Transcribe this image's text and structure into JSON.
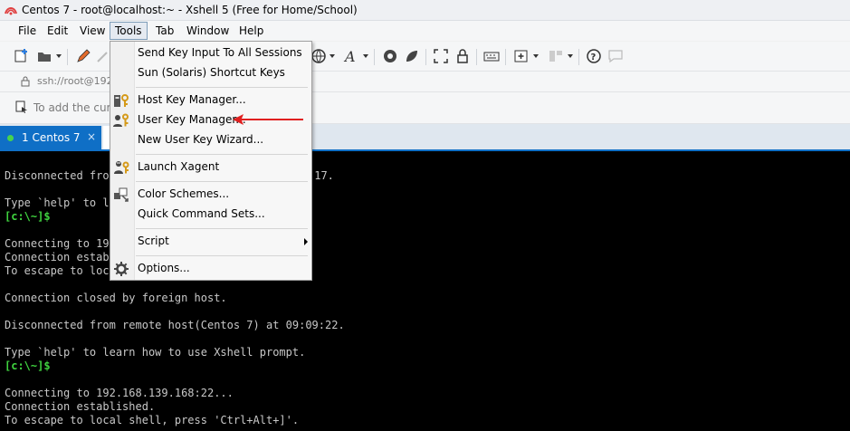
{
  "window": {
    "title": "Centos 7 - root@localhost:~ - Xshell 5 (Free for Home/School)"
  },
  "menubar": {
    "items": [
      "File",
      "Edit",
      "View",
      "Tools",
      "Tab",
      "Window",
      "Help"
    ],
    "active": "Tools"
  },
  "addressbar": {
    "address": "ssh://root@192"
  },
  "hintbar": {
    "text": "To add the curre"
  },
  "tabs": [
    {
      "label": "1 Centos 7",
      "close": "×"
    }
  ],
  "terminal": {
    "lines": [
      {
        "text": "Disconnected from",
        "kind": "normal"
      },
      {
        "text": "",
        "kind": "normal"
      },
      {
        "text": "Type `help' to le",
        "kind": "normal"
      },
      {
        "text": "[c:\\~]$",
        "kind": "prompt"
      },
      {
        "text": "",
        "kind": "normal"
      },
      {
        "text": "Connecting to 192",
        "kind": "normal"
      },
      {
        "text": "Connection establ",
        "kind": "normal"
      },
      {
        "text": "To escape to loca",
        "kind": "normal"
      },
      {
        "text": "",
        "kind": "normal"
      },
      {
        "text": "Connection closed by foreign host.",
        "kind": "normal"
      },
      {
        "text": "",
        "kind": "normal"
      },
      {
        "text": "Disconnected from remote host(Centos 7) at 09:09:22.",
        "kind": "normal"
      },
      {
        "text": "",
        "kind": "normal"
      },
      {
        "text": "Type `help' to learn how to use Xshell prompt.",
        "kind": "normal"
      },
      {
        "text": "[c:\\~]$",
        "kind": "prompt"
      },
      {
        "text": "",
        "kind": "normal"
      },
      {
        "text": "Connecting to 192.168.139.168:22...",
        "kind": "normal"
      },
      {
        "text": "Connection established.",
        "kind": "normal"
      },
      {
        "text": "To escape to local shell, press 'Ctrl+Alt+]'.",
        "kind": "normal"
      }
    ],
    "partial_right": ":17."
  },
  "tools_menu": {
    "items": [
      {
        "label": "Send Key Input To All Sessions",
        "icon": ""
      },
      {
        "label": "Sun (Solaris) Shortcut Keys",
        "icon": ""
      },
      {
        "label": "Host Key Manager...",
        "icon": "host-key-icon"
      },
      {
        "label": "User Key Manager...",
        "icon": "user-key-icon"
      },
      {
        "label": "New User Key Wizard...",
        "icon": ""
      },
      {
        "label": "Launch Xagent",
        "icon": "xagent-icon"
      },
      {
        "label": "Color Schemes...",
        "icon": "color-schemes-icon"
      },
      {
        "label": "Quick Command Sets...",
        "icon": ""
      },
      {
        "label": "Script",
        "icon": "",
        "submenu": true
      },
      {
        "label": "Options...",
        "icon": "gear-icon"
      }
    ]
  },
  "colors": {
    "accent": "#0f6fc6",
    "arrow": "#e02020",
    "prompt": "#3fd23f"
  }
}
